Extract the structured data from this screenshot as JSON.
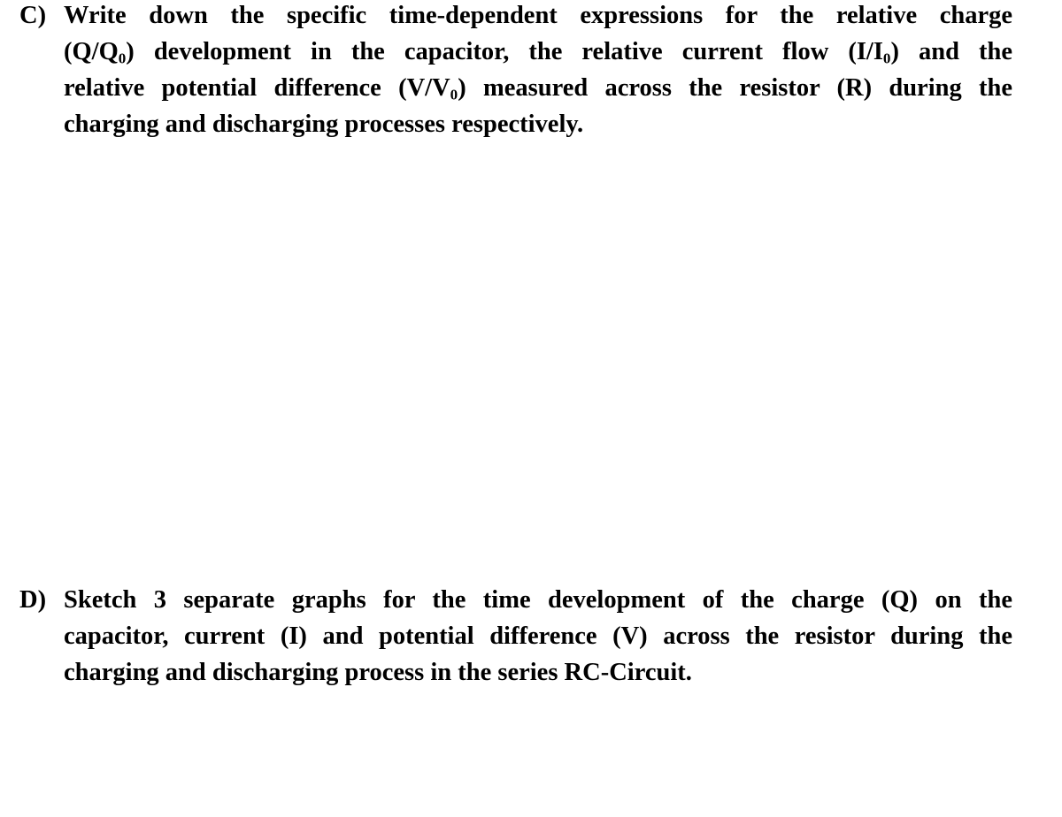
{
  "questions": [
    {
      "label": "C)",
      "lines": [
        {
          "segments": [
            {
              "t": "Write down the specific time-dependent expressions for the relative charge"
            }
          ]
        },
        {
          "segments": [
            {
              "t": "(Q/Q"
            },
            {
              "sub": "0"
            },
            {
              "t": ") development in the capacitor, the relative current flow (I/I"
            },
            {
              "sub": "0"
            },
            {
              "t": ") and the"
            }
          ]
        },
        {
          "segments": [
            {
              "t": "relative potential difference (V/V"
            },
            {
              "sub": "0"
            },
            {
              "t": ") measured across the resistor (R) during the"
            }
          ]
        },
        {
          "segments": [
            {
              "t": "charging and discharging processes respectively."
            }
          ]
        }
      ]
    },
    {
      "label": "D)",
      "lines": [
        {
          "segments": [
            {
              "t": "Sketch 3 separate graphs for the time development of the charge (Q) on the"
            }
          ]
        },
        {
          "segments": [
            {
              "t": "capacitor, current (I) and potential difference (V) across the resistor during the"
            }
          ]
        },
        {
          "segments": [
            {
              "t": "charging and discharging process in the series RC-Circuit."
            }
          ]
        }
      ]
    }
  ],
  "text_color": "#000000",
  "background_color": "#ffffff"
}
